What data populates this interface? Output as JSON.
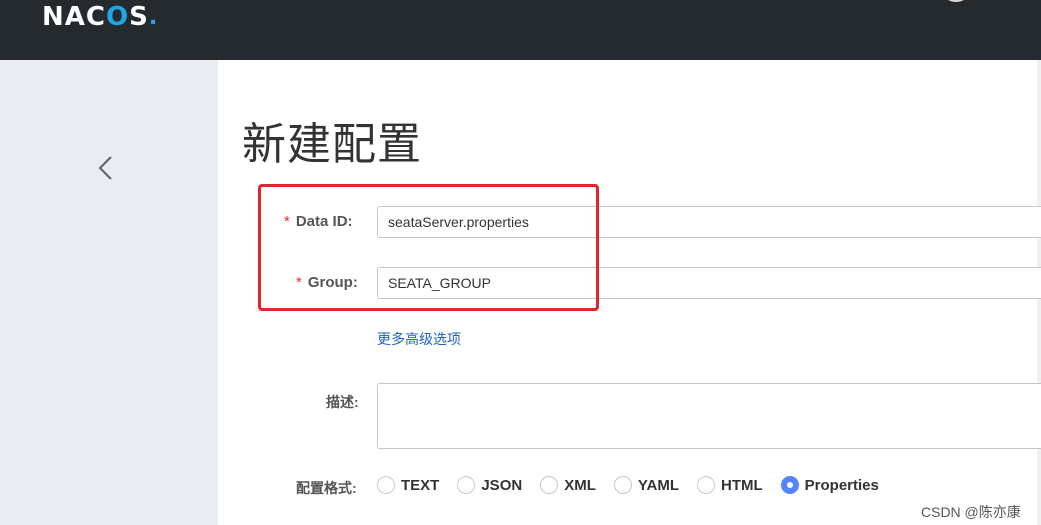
{
  "app": {
    "logo_text_prefix": "NAC",
    "logo_text_o": "O",
    "logo_text_suffix": "S",
    "logo_dot": "."
  },
  "sidebar": {
    "back_icon": "chevron-left-icon"
  },
  "page": {
    "title": "新建配置"
  },
  "form": {
    "data_id": {
      "required_mark": "*",
      "label": "Data ID:",
      "value": "seataServer.properties"
    },
    "group": {
      "required_mark": "*",
      "label": "Group:",
      "value": "SEATA_GROUP"
    },
    "advanced_link": "更多高级选项",
    "description": {
      "label": "描述:",
      "value": ""
    },
    "format": {
      "label": "配置格式:",
      "options": [
        "TEXT",
        "JSON",
        "XML",
        "YAML",
        "HTML",
        "Properties"
      ],
      "selected": "Properties"
    }
  },
  "colors": {
    "topbar": "#252a2f",
    "highlight": "#e0262b",
    "accent": "#5584ff",
    "link": "#1f61c4"
  },
  "watermark": "CSDN @陈亦康"
}
